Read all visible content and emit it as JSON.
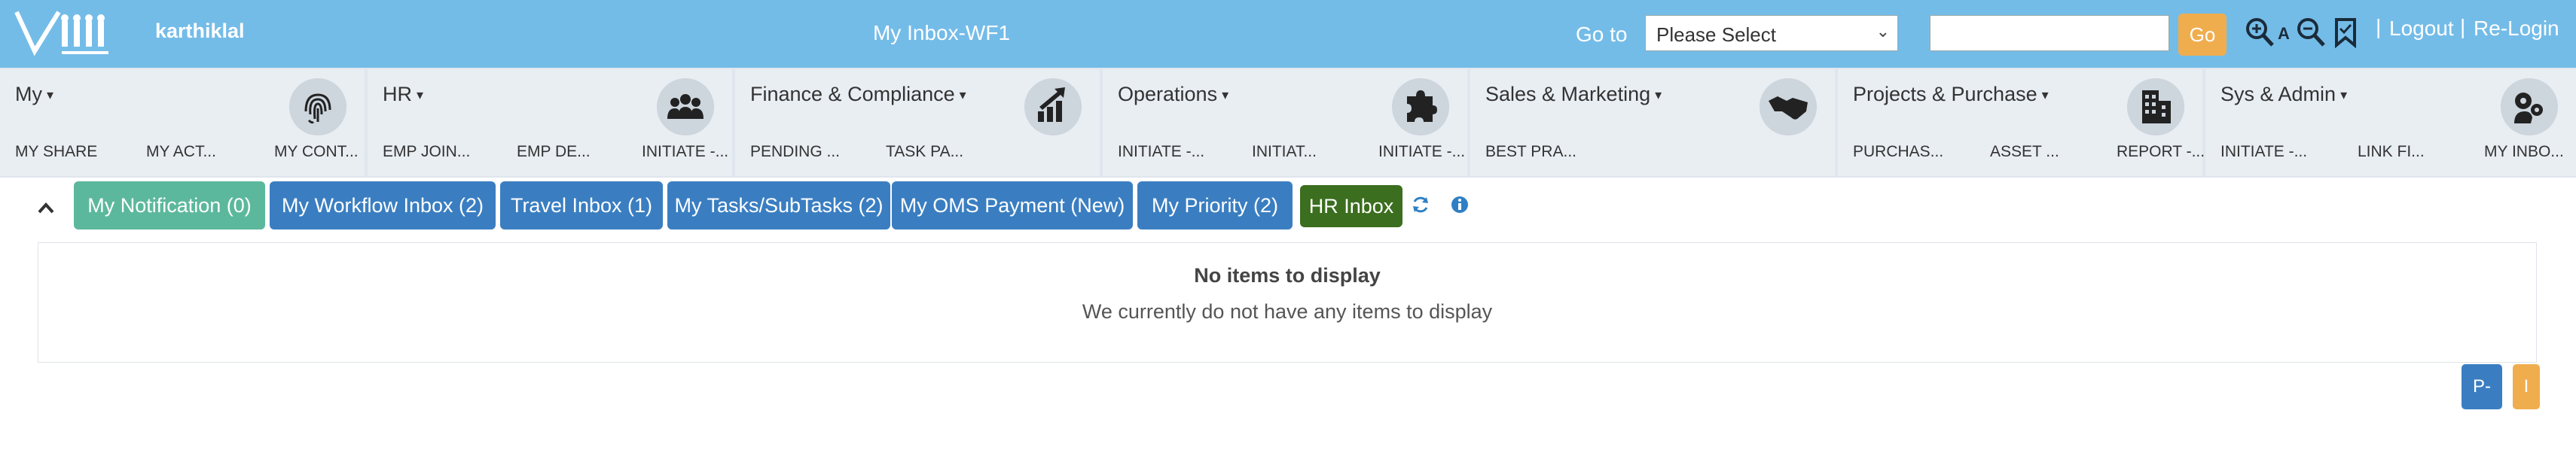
{
  "header": {
    "username": "karthiklal",
    "title": "My Inbox-WF1",
    "goto_label": "Go to",
    "goto_select": "Please Select",
    "go_button": "Go",
    "font_size_label": "A",
    "logout": "Logout",
    "relogin": "Re-Login",
    "separator": "|"
  },
  "modules": [
    {
      "title": "My",
      "icon": "fingerprint-icon",
      "links": [
        "MY SHARE",
        "MY ACT...",
        "MY CONT..."
      ]
    },
    {
      "title": "HR",
      "icon": "people-group-icon",
      "links": [
        "EMP JOIN...",
        "EMP DE...",
        "INITIATE -..."
      ]
    },
    {
      "title": "Finance & Compliance",
      "icon": "bar-chart-growth-icon",
      "links": [
        "PENDING ...",
        "TASK PA..."
      ]
    },
    {
      "title": "Operations",
      "icon": "puzzle-icon",
      "links": [
        "INITIATE -...",
        "INITIAT...",
        "INITIATE -..."
      ]
    },
    {
      "title": "Sales & Marketing",
      "icon": "handshake-icon",
      "links": [
        "BEST PRA..."
      ]
    },
    {
      "title": "Projects & Purchase",
      "icon": "building-icon",
      "links": [
        "PURCHAS...",
        "ASSET ...",
        "REPORT -..."
      ]
    },
    {
      "title": "Sys & Admin",
      "icon": "admin-gear-user-icon",
      "links": [
        "INITIATE -...",
        "LINK FI...",
        "MY INBO..."
      ]
    }
  ],
  "tabs": [
    {
      "label": "My Notification (0)",
      "color": "#5cb89c"
    },
    {
      "label": "My Workflow Inbox (2)",
      "color": "#3a7ec1"
    },
    {
      "label": "Travel Inbox (1)",
      "color": "#3a7ec1"
    },
    {
      "label": "My Tasks/SubTasks (2)",
      "color": "#3a7ec1"
    },
    {
      "label": "My OMS Payment (New)",
      "color": "#3a7ec1"
    },
    {
      "label": "My Priority (2)",
      "color": "#3a7ec1"
    },
    {
      "label": "HR Inbox",
      "color": "#3b6e1e"
    }
  ],
  "panel": {
    "empty_title": "No items to display",
    "empty_message": "We currently do not have any items to display"
  },
  "footer_buttons": {
    "p_minus": "P-",
    "i": "I"
  },
  "colors": {
    "header_bg": "#74bce8",
    "go_button": "#f0ad4e",
    "module_bg": "#e9eef3"
  }
}
